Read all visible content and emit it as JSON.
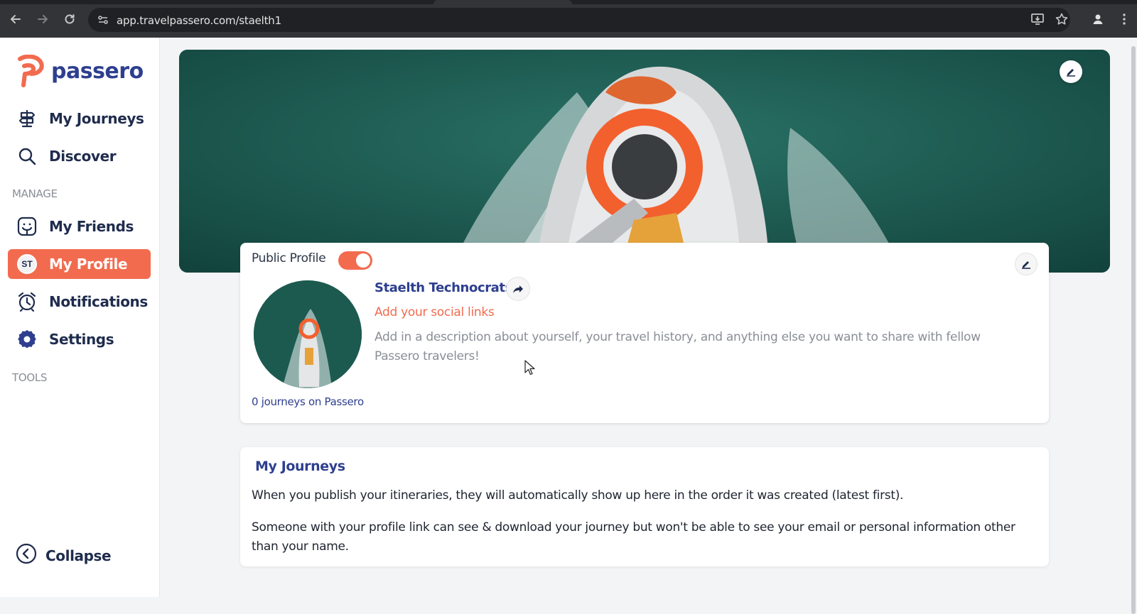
{
  "browser": {
    "url": "app.travelpassero.com/staelth1"
  },
  "brand": {
    "name": "passero",
    "accent": "#f26b4f",
    "primary": "#2e3f8f"
  },
  "sidebar": {
    "items_top": [
      {
        "label": "My Journeys",
        "icon": "signpost-icon"
      },
      {
        "label": "Discover",
        "icon": "search-icon"
      }
    ],
    "manage_label": "MANAGE",
    "items_manage": [
      {
        "label": "My Friends",
        "icon": "friends-icon"
      },
      {
        "label": "My Profile",
        "icon": "avatar",
        "initials": "ST",
        "active": true
      },
      {
        "label": "Notifications",
        "icon": "alarm-clock-icon"
      },
      {
        "label": "Settings",
        "icon": "gear-icon"
      }
    ],
    "tools_label": "TOOLS",
    "collapse_label": "Collapse"
  },
  "profile": {
    "public_label": "Public Profile",
    "public_enabled": true,
    "name": "Staelth Technocrats",
    "social_link_text": "Add your social links",
    "description_placeholder": "Add in a description about yourself, your travel history, and anything else you want to share with fellow Passero travelers!",
    "journeys_count_text": "0 journeys on Passero"
  },
  "journeys": {
    "title": "My Journeys",
    "paragraph1": "When you publish your itineraries, they will automatically show up here in the order it was created (latest first).",
    "paragraph2": "Someone with your profile link can see & download your journey but won't be able to see your email or personal information other than your name."
  }
}
